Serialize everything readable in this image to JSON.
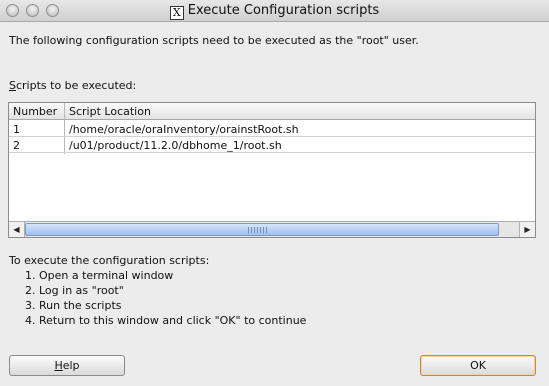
{
  "window": {
    "title": "Execute Configuration scripts"
  },
  "intro": "The following configuration scripts need to be executed as the \"root\" user.",
  "scripts_label": {
    "mnemonic": "S",
    "rest": "cripts to be executed:"
  },
  "table": {
    "headers": [
      "Number",
      "Script Location"
    ],
    "rows": [
      {
        "number": "1",
        "location": "/home/oracle/oraInventory/orainstRoot.sh"
      },
      {
        "number": "2",
        "location": "/u01/product/11.2.0/dbhome_1/root.sh"
      }
    ]
  },
  "instructions": {
    "heading": "To execute the configuration scripts:",
    "steps": [
      "1. Open a terminal window",
      "2. Log in as \"root\"",
      "3. Run the scripts",
      "4. Return to this window and click \"OK\" to continue"
    ]
  },
  "buttons": {
    "help": {
      "mnemonic": "H",
      "rest": "elp"
    },
    "ok": "OK"
  },
  "icons": {
    "title_icon": "x11-icon",
    "scroll_left": "arrow-left-icon",
    "scroll_right": "arrow-right-icon"
  }
}
